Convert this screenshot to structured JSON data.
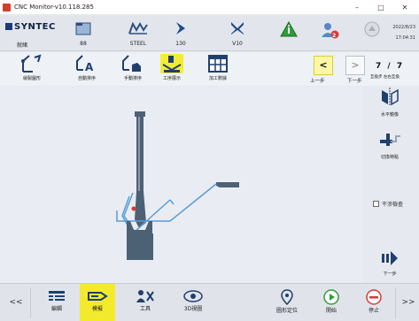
{
  "window": {
    "title": "CNC Monitor-v10.118.285",
    "minimize": "–",
    "maximize": "□",
    "close": "✕"
  },
  "status": {
    "brand": "SYNTEC",
    "state": "就緒",
    "program_num": "88",
    "material": "STEEL",
    "length": "130",
    "tool": "V10",
    "date": "2022/8/23",
    "time": "17:04:31",
    "alarm_badge": "2"
  },
  "toolbar": {
    "items": [
      {
        "label": "繪製圖形"
      },
      {
        "label": "自動排序"
      },
      {
        "label": "手動排序"
      },
      {
        "label": "工序展示"
      },
      {
        "label": "加工數據"
      }
    ],
    "prev_label": "上一步",
    "next_label": "下一步",
    "prev_symbol": "<",
    "next_symbol": ">"
  },
  "right_panel": {
    "pager": "7 / 7",
    "pager_sub": "互換步  左右互換",
    "mirror_label": "水平鏡像",
    "switch_label": "切換特點",
    "checkbox_label": "干涉檢查",
    "next_step_label": "下一步"
  },
  "bottom": {
    "left_arrow": "<<",
    "right_arrow": ">>",
    "items": [
      {
        "label": "編輯"
      },
      {
        "label": "模擬"
      },
      {
        "label": "工具"
      },
      {
        "label": "3D視圖"
      },
      {
        "label": "圖形定位"
      },
      {
        "label": "開始"
      },
      {
        "label": "停止"
      }
    ]
  },
  "colors": {
    "accent_yellow": "#f3ea2c",
    "part_blue": "#5a9bd6",
    "die_gray": "#4d6175",
    "alarm_red": "#d83a3a"
  }
}
